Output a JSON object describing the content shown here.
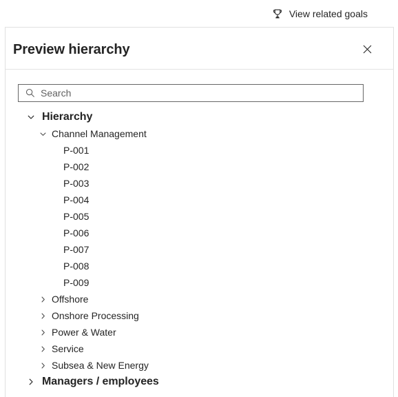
{
  "topbar": {
    "goals_link_label": "View related goals",
    "goals_icon": "trophy-icon"
  },
  "panel": {
    "title": "Preview hierarchy",
    "close_icon": "close-icon",
    "close_label": "Close"
  },
  "search": {
    "placeholder": "Search",
    "value": "",
    "icon": "search-icon"
  },
  "tree": {
    "nodes": [
      {
        "label": "Hierarchy",
        "level": 0,
        "state": "expanded",
        "icon": "chevron-down-icon"
      },
      {
        "label": "Channel Management",
        "level": 1,
        "state": "expanded",
        "icon": "chevron-down-icon"
      },
      {
        "label": "P-001",
        "level": 2,
        "state": "leaf",
        "icon": "none"
      },
      {
        "label": "P-002",
        "level": 2,
        "state": "leaf",
        "icon": "none"
      },
      {
        "label": "P-003",
        "level": 2,
        "state": "leaf",
        "icon": "none"
      },
      {
        "label": "P-004",
        "level": 2,
        "state": "leaf",
        "icon": "none"
      },
      {
        "label": "P-005",
        "level": 2,
        "state": "leaf",
        "icon": "none"
      },
      {
        "label": "P-006",
        "level": 2,
        "state": "leaf",
        "icon": "none"
      },
      {
        "label": "P-007",
        "level": 2,
        "state": "leaf",
        "icon": "none"
      },
      {
        "label": "P-008",
        "level": 2,
        "state": "leaf",
        "icon": "none"
      },
      {
        "label": "P-009",
        "level": 2,
        "state": "leaf",
        "icon": "none"
      },
      {
        "label": "Offshore",
        "level": 1,
        "state": "collapsed",
        "icon": "chevron-right-icon"
      },
      {
        "label": "Onshore Processing",
        "level": 1,
        "state": "collapsed",
        "icon": "chevron-right-icon"
      },
      {
        "label": "Power & Water",
        "level": 1,
        "state": "collapsed",
        "icon": "chevron-right-icon"
      },
      {
        "label": "Service",
        "level": 1,
        "state": "collapsed",
        "icon": "chevron-right-icon"
      },
      {
        "label": "Subsea & New Energy",
        "level": 1,
        "state": "collapsed",
        "icon": "chevron-right-icon"
      },
      {
        "label": "Managers / employees",
        "level": 0,
        "state": "collapsed",
        "icon": "chevron-right-icon"
      }
    ]
  },
  "colors": {
    "text": "#242424",
    "border": "#e0e0e0",
    "field_border": "#666666",
    "placeholder": "#616161"
  }
}
